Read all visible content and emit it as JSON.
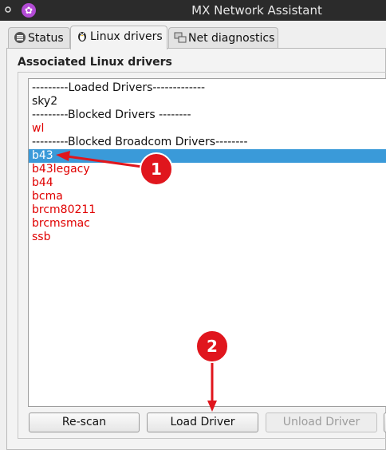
{
  "window": {
    "title": "MX Network Assistant"
  },
  "tabs": [
    {
      "label": "Status",
      "icon": "status-icon"
    },
    {
      "label": "Linux drivers",
      "icon": "penguin-icon"
    },
    {
      "label": "Net diagnostics",
      "icon": "network-icon"
    }
  ],
  "group": {
    "title": "Associated Linux drivers"
  },
  "drivers": [
    {
      "text": "---------Loaded Drivers-------------",
      "kind": "header"
    },
    {
      "text": "sky2",
      "kind": "normal"
    },
    {
      "text": "---------Blocked Drivers --------",
      "kind": "header"
    },
    {
      "text": "wl",
      "kind": "blocked"
    },
    {
      "text": "---------Blocked Broadcom Drivers--------",
      "kind": "header"
    },
    {
      "text": "b43",
      "kind": "selected"
    },
    {
      "text": "b43legacy",
      "kind": "blocked"
    },
    {
      "text": "b44",
      "kind": "blocked"
    },
    {
      "text": "bcma",
      "kind": "blocked"
    },
    {
      "text": "brcm80211",
      "kind": "blocked"
    },
    {
      "text": "brcmsmac",
      "kind": "blocked"
    },
    {
      "text": "ssb",
      "kind": "blocked"
    }
  ],
  "buttons": {
    "rescan": "Re-scan",
    "load_driver": "Load Driver",
    "unload_driver": "Unload Driver"
  },
  "annotations": [
    {
      "number": "1",
      "color": "#e0161d"
    },
    {
      "number": "2",
      "color": "#e0161d"
    }
  ],
  "colors": {
    "blocked": "#e00000",
    "selection": "#3a9ad9",
    "titlebar": "#2b2b2b",
    "app_icon": "#b34bd6"
  }
}
